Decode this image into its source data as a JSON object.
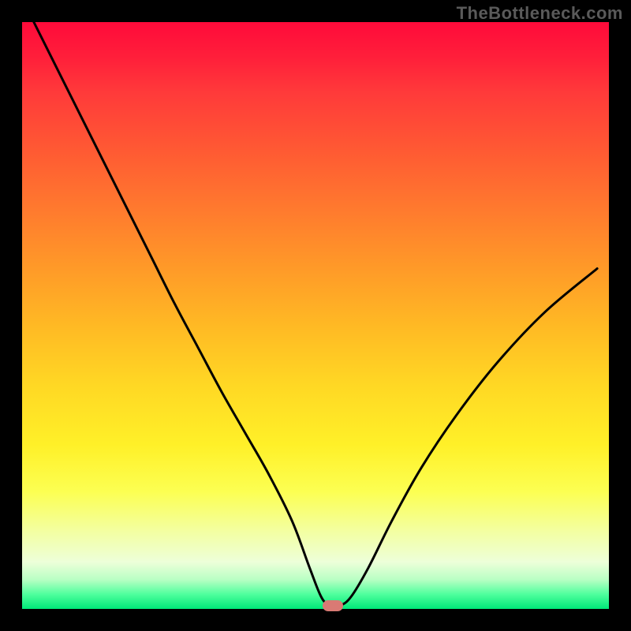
{
  "watermark": "TheBottleneck.com",
  "colors": {
    "frame_background": "#000000",
    "watermark_text": "#5a5a5a",
    "curve_stroke": "#000000",
    "marker_fill": "#d97a74",
    "gradient_stops": [
      "#ff0a3a",
      "#ff1f3a",
      "#ff3a3a",
      "#ff5a33",
      "#ff7a2e",
      "#ff9a28",
      "#ffba24",
      "#ffd824",
      "#fff028",
      "#fcff52",
      "#f3ffa4",
      "#edffd9",
      "#b9ffc4",
      "#4fff9d",
      "#00e878"
    ]
  },
  "chart_data": {
    "type": "line",
    "title": "",
    "xlabel": "",
    "ylabel": "",
    "xlim": [
      0,
      100
    ],
    "ylim": [
      0,
      100
    ],
    "grid": false,
    "legend": false,
    "series": [
      {
        "name": "bottleneck-curve",
        "x": [
          2,
          6,
          10,
          14,
          18,
          22,
          26,
          30,
          34,
          38,
          42,
          46,
          49,
          51,
          52.5,
          54,
          56,
          59,
          63,
          68,
          74,
          81,
          89,
          98
        ],
        "y": [
          100,
          92,
          84,
          76,
          68,
          60,
          52,
          44.5,
          37,
          30,
          23,
          15,
          7,
          2,
          0.5,
          0.5,
          2,
          7,
          15,
          24,
          33,
          42,
          50.5,
          58
        ]
      }
    ],
    "marker": {
      "x": 53,
      "y": 0.5
    },
    "notes": "V-shaped bottleneck curve over a vertical red→orange→yellow→green gradient; minimum around x≈53 at y≈0. Values are estimated from pixel geometry."
  }
}
